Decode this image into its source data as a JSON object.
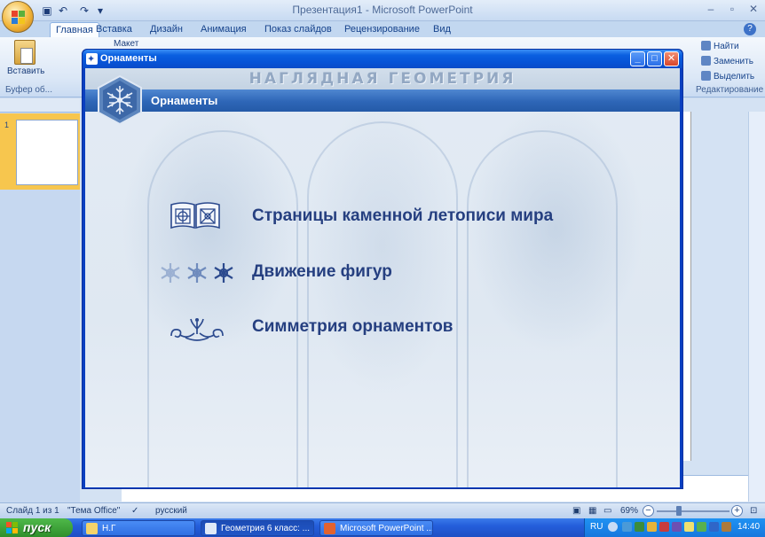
{
  "powerpoint": {
    "window_title": "Презентация1 - Microsoft PowerPoint",
    "help_glyph": "?",
    "tabs": [
      "Главная",
      "Вставка",
      "Дизайн",
      "Анимация",
      "Показ слайдов",
      "Рецензирование",
      "Вид"
    ],
    "active_tab": "Главная",
    "ribbon": {
      "paste_label": "Вставить",
      "layout_label": "Макет",
      "clipboard_group": "Буфер об...",
      "editing_group": "Редактирование",
      "find": "Найти",
      "replace": "Заменить",
      "select": "Выделить"
    },
    "thumbnail_number": "1",
    "status": {
      "slide": "Слайд 1 из 1",
      "theme": "\"Тема Office\"",
      "language": "русский",
      "zoom": "69%"
    }
  },
  "ornaments_window": {
    "title": "Орнаменты",
    "header": "НАГЛЯДНАЯ ГЕОМЕТРИЯ",
    "section": "Орнаменты",
    "menu": [
      {
        "label": "Страницы каменной летописи мира",
        "icon": "book-ornament-icon"
      },
      {
        "label": "Движение фигур",
        "icon": "snowflake-motion-icon"
      },
      {
        "label": "Симметрия орнаментов",
        "icon": "flourish-ornament-icon"
      }
    ],
    "accent_color": "#253f80"
  },
  "taskbar": {
    "start_label": "пуск",
    "tasks": [
      {
        "label": "Н.Г",
        "icon": "folder-icon"
      },
      {
        "label": "Геометрия 6 класс: ...",
        "icon": "ornaments-app-icon"
      },
      {
        "label": "Microsoft PowerPoint ...",
        "icon": "powerpoint-icon"
      }
    ],
    "language": "RU",
    "clock": "14:40"
  }
}
